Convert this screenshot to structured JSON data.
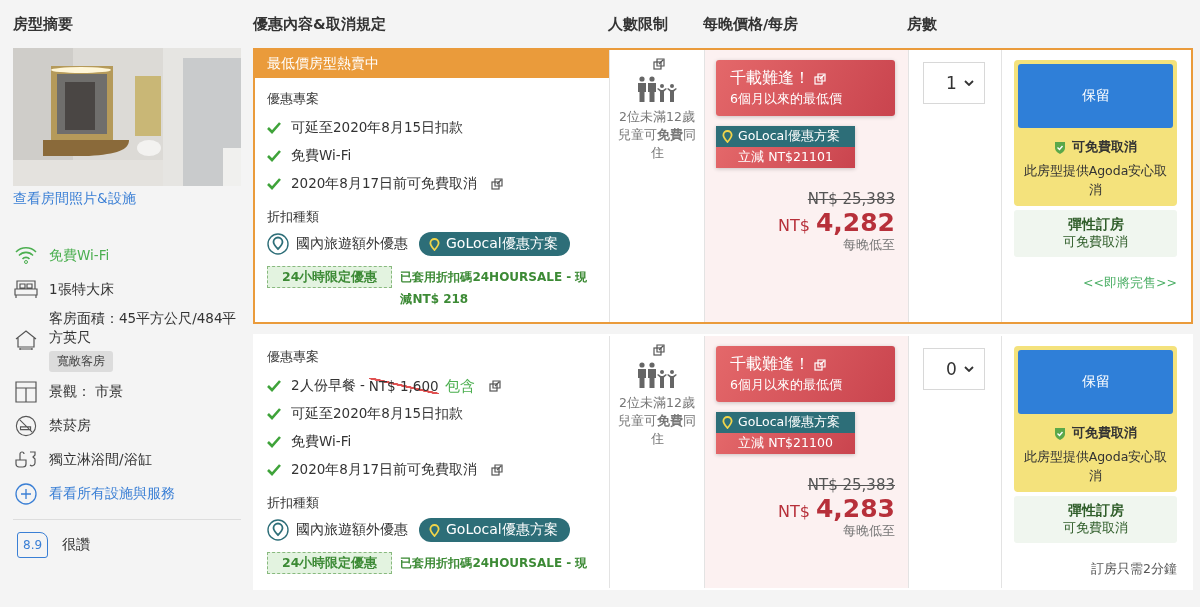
{
  "sidebar": {
    "title": "房型摘要",
    "photo_link": "查看房間照片&設施",
    "amenities": [
      {
        "kind": "wifi",
        "text": "免費Wi-Fi",
        "highlight": true
      },
      {
        "kind": "bed",
        "text": "1張特大床",
        "highlight": false
      },
      {
        "kind": "size",
        "text": "客房面積：45平方公尺/484平方英尺",
        "tag": "寬敞客房",
        "highlight": false
      },
      {
        "kind": "view",
        "text": "景觀： 市景",
        "highlight": false
      },
      {
        "kind": "nosmoking",
        "text": "禁菸房",
        "highlight": false
      },
      {
        "kind": "shower",
        "text": "獨立淋浴間/浴缸",
        "highlight": false
      }
    ],
    "all_link": "看看所有設施與服務",
    "rating": {
      "score": "8.9",
      "label": "很讚"
    }
  },
  "columns": [
    "優惠內容&取消規定",
    "人數限制",
    "每晚價格/每房",
    "房數"
  ],
  "rooms": [
    {
      "featured": true,
      "banner": "最低價房型熱賣中",
      "offer_title": "優惠專案",
      "benefits": [
        {
          "kind": "plain",
          "text": "可延至2020年8月15日扣款",
          "info": false
        },
        {
          "kind": "plain",
          "text": "免費Wi-Fi",
          "info": false
        },
        {
          "kind": "plain",
          "text": "2020年8月17日前可免費取消",
          "info": true
        }
      ],
      "discount_title": "折扣種類",
      "discount_type": "國內旅遊額外優惠",
      "program": "GoLocal優惠方案",
      "coupon_tag": "24小時限定優惠",
      "coupon_text": "已套用折扣碼24HOURSALE - 現減NT$ 218",
      "occupancy": "2位未滿12歲兒童可**免費**同住",
      "deal_title": "千載難逢！",
      "deal_sub": "6個月以來的最低價",
      "promo_name": "GoLocal優惠方案",
      "promo_saving": "立減 NT$21101",
      "old_price": "NT$ 25,383",
      "currency": "NT$",
      "price": "4,282",
      "price_note": "每晚低至",
      "room_count": "1",
      "book": "保留",
      "cancel_title": "可免費取消",
      "cancel_text": "此房型提供Agoda安心取消",
      "flex_title": "彈性訂房",
      "flex_text": "可免費取消",
      "footer": {
        "kind": "urgent",
        "text": "<<即將完售>>"
      }
    },
    {
      "featured": false,
      "offer_title": "優惠專案",
      "benefits": [
        {
          "kind": "breakfast",
          "text": "2人份早餐 - ",
          "old_price": "NT$ 1,600",
          "included": "包含",
          "info": true
        },
        {
          "kind": "plain",
          "text": "可延至2020年8月15日扣款",
          "info": false
        },
        {
          "kind": "plain",
          "text": "免費Wi-Fi",
          "info": false
        },
        {
          "kind": "plain",
          "text": "2020年8月17日前可免費取消",
          "info": true
        }
      ],
      "discount_title": "折扣種類",
      "discount_type": "國內旅遊額外優惠",
      "program": "GoLocal優惠方案",
      "coupon_tag": "24小時限定優惠",
      "coupon_text": "已套用折扣碼24HOURSALE - 現",
      "occupancy": "2位未滿12歲兒童可**免費**同住",
      "deal_title": "千載難逢！",
      "deal_sub": "6個月以來的最低價",
      "promo_name": "GoLocal優惠方案",
      "promo_saving": "立減 NT$21100",
      "old_price": "NT$ 25,383",
      "currency": "NT$",
      "price": "4,283",
      "price_note": "每晚低至",
      "room_count": "0",
      "book": "保留",
      "cancel_title": "可免費取消",
      "cancel_text": "此房型提供Agoda安心取消",
      "flex_title": "彈性訂房",
      "flex_text": "可免費取消",
      "footer": {
        "kind": "note",
        "text": "訂房只需2分鐘"
      }
    }
  ]
}
